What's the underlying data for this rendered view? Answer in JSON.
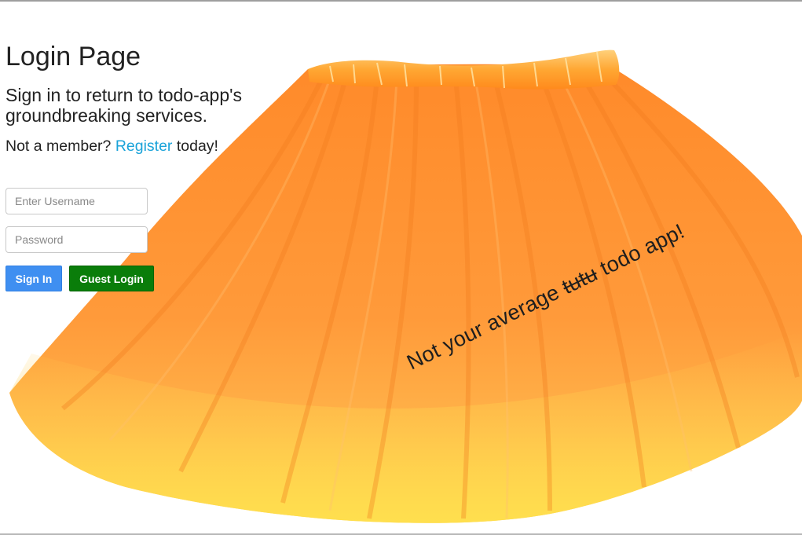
{
  "login": {
    "title": "Login Page",
    "subtitle": "Sign in to return to todo-app's groundbreaking services.",
    "member_prefix": "Not a member? ",
    "register_link": "Register",
    "member_suffix": " today!",
    "username_placeholder": "Enter Username",
    "password_placeholder": "Password",
    "signin_label": "Sign In",
    "guest_label": "Guest Login"
  },
  "tagline": {
    "before": "Not your average ",
    "struck": "tutu",
    "after": " todo app!"
  },
  "colors": {
    "link": "#1aa3d9",
    "signin_button": "#3f8ff1",
    "guest_button": "#0a7d0a",
    "tutu_orange": "#ff8a2e"
  }
}
